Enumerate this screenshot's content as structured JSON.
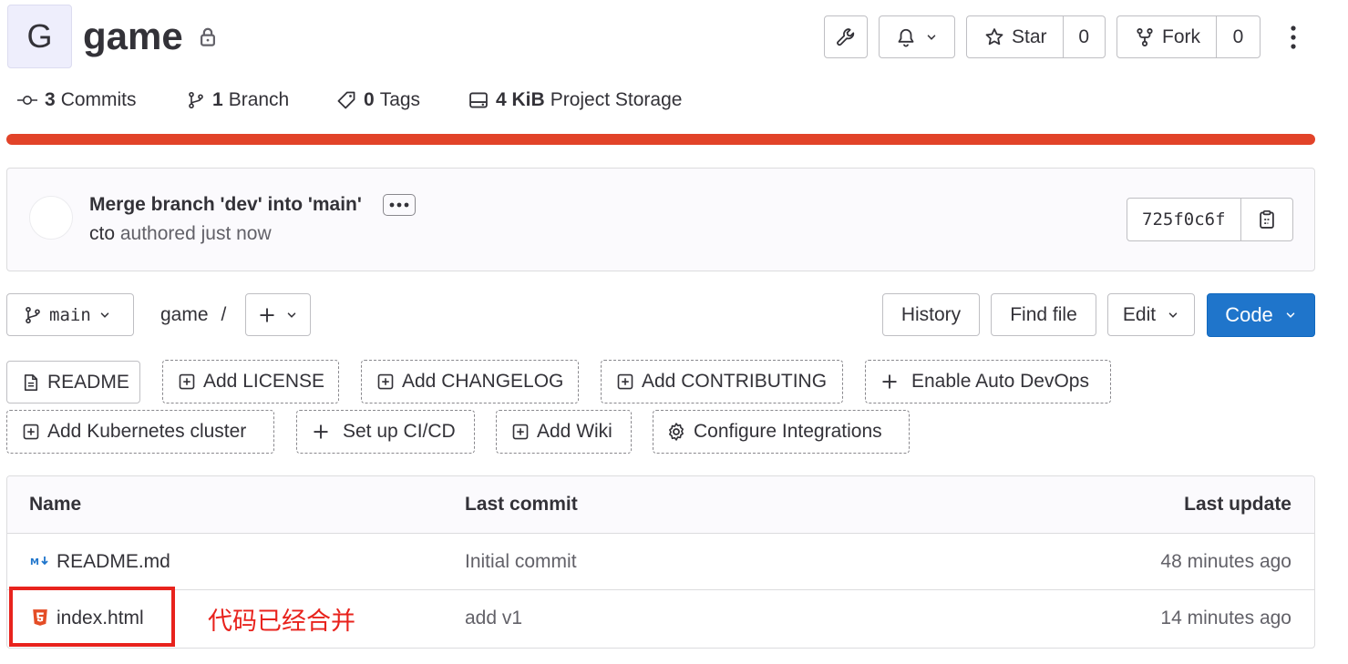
{
  "project": {
    "avatar_letter": "G",
    "name": "game",
    "visibility_icon": "lock-icon"
  },
  "actions": {
    "star_label": "Star",
    "star_count": "0",
    "fork_label": "Fork",
    "fork_count": "0"
  },
  "stats": {
    "commits_count": "3",
    "commits_label": "Commits",
    "branch_count": "1",
    "branch_label": "Branch",
    "tags_count": "0",
    "tags_label": "Tags",
    "storage_size": "4 KiB",
    "storage_label": "Project Storage"
  },
  "commit": {
    "title": "Merge branch 'dev' into 'main'",
    "author": "cto",
    "authored_text": "authored just now",
    "sha": "725f0c6f"
  },
  "repo_nav": {
    "branch": "main",
    "path_root": "game",
    "path_sep": "/",
    "history_label": "History",
    "find_file_label": "Find file",
    "edit_label": "Edit",
    "code_label": "Code"
  },
  "shortcuts": [
    "README",
    "Add LICENSE",
    "Add CHANGELOG",
    "Add CONTRIBUTING",
    "Enable Auto DevOps",
    "Add Kubernetes cluster",
    "Set up CI/CD",
    "Add Wiki",
    "Configure Integrations"
  ],
  "table": {
    "headers": {
      "name": "Name",
      "last_commit": "Last commit",
      "last_update": "Last update"
    },
    "rows": [
      {
        "name": "README.md",
        "icon": "markdown-icon",
        "commit": "Initial commit",
        "updated": "48 minutes ago"
      },
      {
        "name": "index.html",
        "icon": "html5-icon",
        "commit": "add v1",
        "updated": "14 minutes ago"
      }
    ]
  },
  "annotation": {
    "text": "代码已经合并",
    "color": "#e8231d"
  },
  "colors": {
    "accent": "#1f75cb",
    "progress": "#e24329"
  }
}
